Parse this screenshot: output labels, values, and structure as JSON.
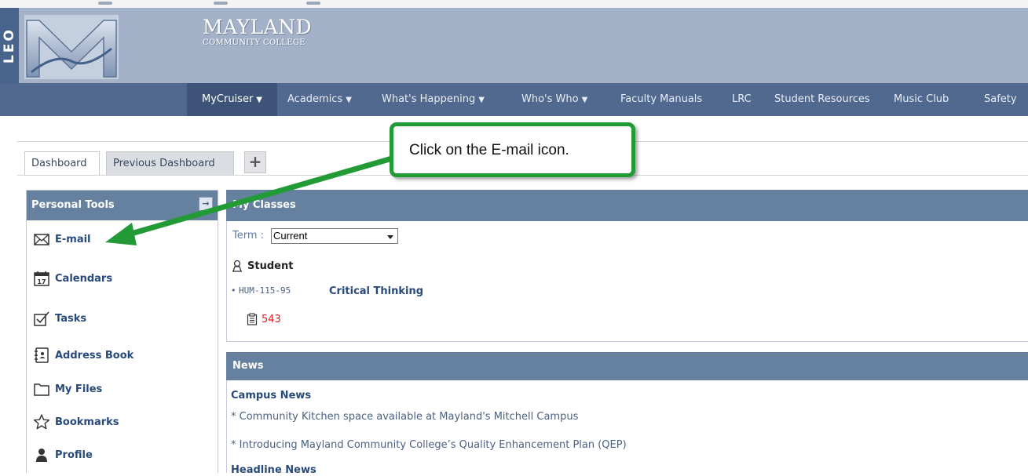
{
  "header": {
    "side_label": "LEO",
    "college_name": "MAYLAND",
    "college_sub": "COMMUNITY COLLEGE"
  },
  "nav": {
    "items": [
      {
        "label": "MyCruiser",
        "dropdown": true,
        "active": true
      },
      {
        "label": "Academics",
        "dropdown": true
      },
      {
        "label": "What's Happening",
        "dropdown": true
      },
      {
        "label": "Who's Who",
        "dropdown": true
      },
      {
        "label": "Faculty Manuals"
      },
      {
        "label": "LRC"
      },
      {
        "label": "Student Resources"
      },
      {
        "label": "Music Club"
      },
      {
        "label": "Safety"
      }
    ]
  },
  "tabs": {
    "dashboard": "Dashboard",
    "previous": "Previous Dashboard",
    "add": "+"
  },
  "sidebar": {
    "title": "Personal Tools",
    "collapse": "→",
    "items": [
      {
        "label": "E-mail",
        "icon": "envelope-icon"
      },
      {
        "label": "Calendars",
        "icon": "calendar-icon"
      },
      {
        "label": "Tasks",
        "icon": "checkbox-icon"
      },
      {
        "label": "Address Book",
        "icon": "address-book-icon"
      },
      {
        "label": "My Files",
        "icon": "folder-icon"
      },
      {
        "label": "Bookmarks",
        "icon": "star-icon"
      },
      {
        "label": "Profile",
        "icon": "person-icon"
      }
    ],
    "calendar_day": "17"
  },
  "classes": {
    "title": "My Classes",
    "term_label": "Term :",
    "term_value": "Current",
    "role": "Student",
    "course_code": "HUM-115-95",
    "course_name": "Critical Thinking",
    "count": "543"
  },
  "news": {
    "title": "News",
    "section1": "Campus News",
    "items": [
      "Community Kitchen space available at Mayland's Mitchell Campus",
      "Introducing Mayland Community College’s Quality Enhancement Plan (QEP)"
    ],
    "section2": "Headline News"
  },
  "callout": {
    "text": "Click on the E-mail icon."
  },
  "colors": {
    "banner": "#a3b2c8",
    "nav": "#52698f",
    "panel_header": "#66809f",
    "link": "#284a7a",
    "callout_border": "#229a36",
    "count": "#e0191b"
  }
}
